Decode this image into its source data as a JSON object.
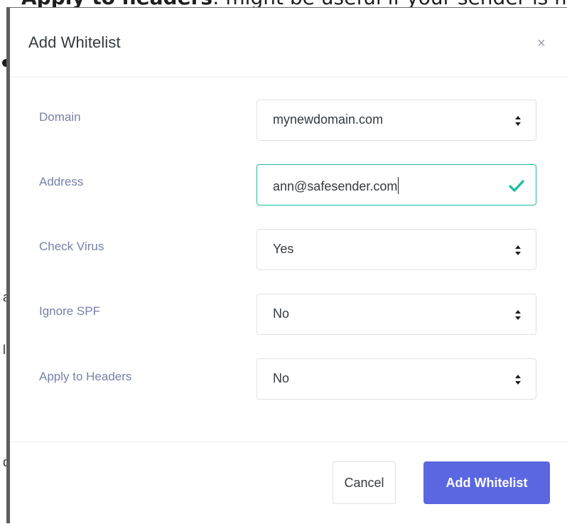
{
  "background": {
    "heading_bold": "Apply to headers",
    "heading_rest": ": might be useful if your sender is m",
    "fragments": [
      "a",
      "l",
      "d"
    ]
  },
  "dialog": {
    "title": "Add Whitelist",
    "close_glyph": "×",
    "fields": {
      "domain": {
        "label": "Domain",
        "value": "mynewdomain.com",
        "type": "select"
      },
      "address": {
        "label": "Address",
        "value": "ann@safesender.com",
        "type": "text",
        "valid": true
      },
      "check_virus": {
        "label": "Check Virus",
        "value": "Yes",
        "type": "select"
      },
      "ignore_spf": {
        "label": "Ignore SPF",
        "value": "No",
        "type": "select"
      },
      "apply_headers": {
        "label": "Apply to Headers",
        "value": "No",
        "type": "select"
      }
    },
    "buttons": {
      "cancel": "Cancel",
      "submit": "Add Whitelist"
    }
  },
  "colors": {
    "primary": "#5b67e0",
    "label": "#7880a8",
    "valid": "#1abc9c"
  },
  "icons": {
    "select_arrow": "updown-arrows-icon",
    "valid": "check-icon",
    "close": "close-icon"
  }
}
